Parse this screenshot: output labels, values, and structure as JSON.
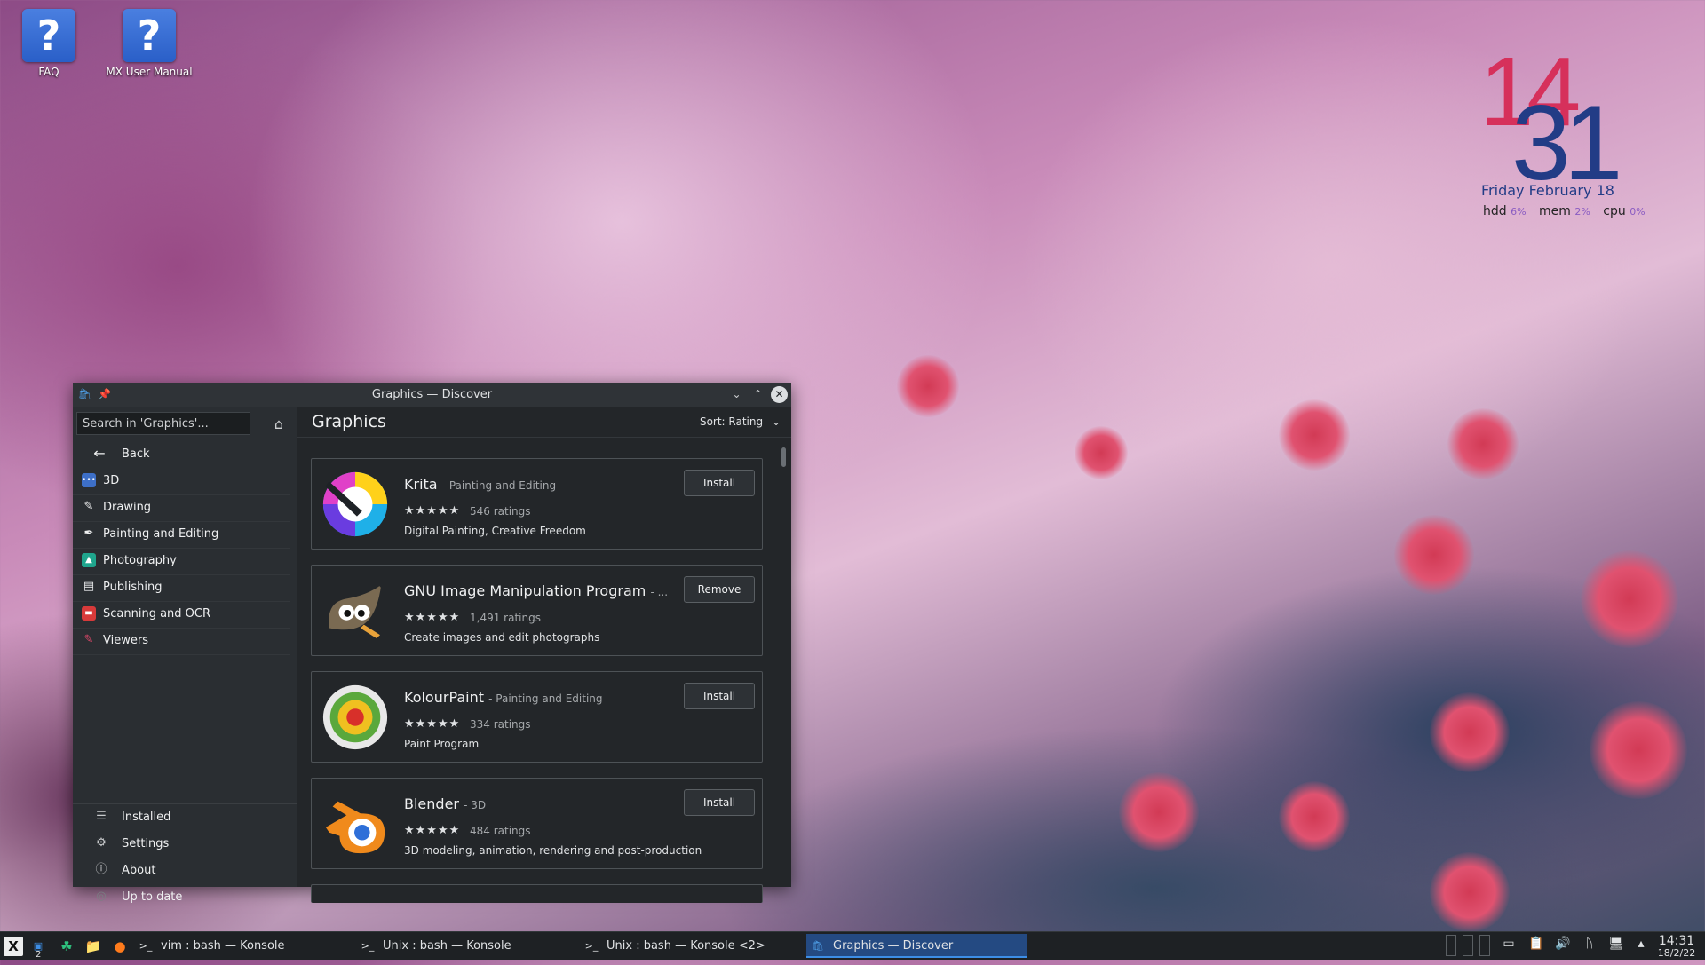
{
  "desktop": {
    "icons": [
      {
        "label": "FAQ",
        "glyph": "?"
      },
      {
        "label": "MX User Manual",
        "glyph": "?"
      }
    ],
    "clock": {
      "hour": "14",
      "minute": "31",
      "date": "Friday February 18",
      "hdd_label": "hdd",
      "hdd_pct": "6%",
      "mem_label": "mem",
      "mem_pct": "2%",
      "cpu_label": "cpu",
      "cpu_pct": "0%"
    }
  },
  "window": {
    "title": "Graphics — Discover",
    "search_placeholder": "Search in 'Graphics'...",
    "back_label": "Back",
    "categories": [
      {
        "label": "3D",
        "icon": "3d-icon",
        "color": "#3d6fc7"
      },
      {
        "label": "Drawing",
        "icon": "pencil-icon",
        "color": ""
      },
      {
        "label": "Painting and Editing",
        "icon": "brush-icon",
        "color": ""
      },
      {
        "label": "Photography",
        "icon": "photo-icon",
        "color": "#1fa58d"
      },
      {
        "label": "Publishing",
        "icon": "document-icon",
        "color": ""
      },
      {
        "label": "Scanning and OCR",
        "icon": "scanner-icon",
        "color": "#d83a3a"
      },
      {
        "label": "Viewers",
        "icon": "viewer-icon",
        "color": "#c83b5a"
      }
    ],
    "bottom_nav": [
      {
        "label": "Installed",
        "icon": "list-icon"
      },
      {
        "label": "Settings",
        "icon": "gear-icon"
      },
      {
        "label": "About",
        "icon": "info-icon"
      },
      {
        "label": "Up to date",
        "icon": "update-icon"
      }
    ],
    "page_title": "Graphics",
    "sort_label": "Sort: Rating",
    "apps": [
      {
        "name": "Krita",
        "category": "- Painting and Editing",
        "stars": "★★★★★",
        "ratings": "546 ratings",
        "description": "Digital Painting, Creative Freedom",
        "action": "Install"
      },
      {
        "name": "GNU Image Manipulation Program",
        "category": "- ...",
        "stars": "★★★★★",
        "ratings": "1,491 ratings",
        "description": "Create images and edit photographs",
        "action": "Remove"
      },
      {
        "name": "KolourPaint",
        "category": "- Painting and Editing",
        "stars": "★★★★★",
        "ratings": "334 ratings",
        "description": "Paint Program",
        "action": "Install"
      },
      {
        "name": "Blender",
        "category": "- 3D",
        "stars": "★★★★★",
        "ratings": "484 ratings",
        "description": "3D modeling, animation, rendering and post-production",
        "action": "Install"
      }
    ]
  },
  "taskbar": {
    "desktop_number": "2",
    "tasks": [
      {
        "label": "vim : bash — Konsole",
        "icon": ">_"
      },
      {
        "label": "Unix : bash — Konsole",
        "icon": ">_"
      },
      {
        "label": "Unix : bash — Konsole <2>",
        "icon": ">_"
      },
      {
        "label": "Graphics — Discover",
        "icon": "bag"
      }
    ],
    "time": "14:31",
    "date": "18/2/22"
  }
}
